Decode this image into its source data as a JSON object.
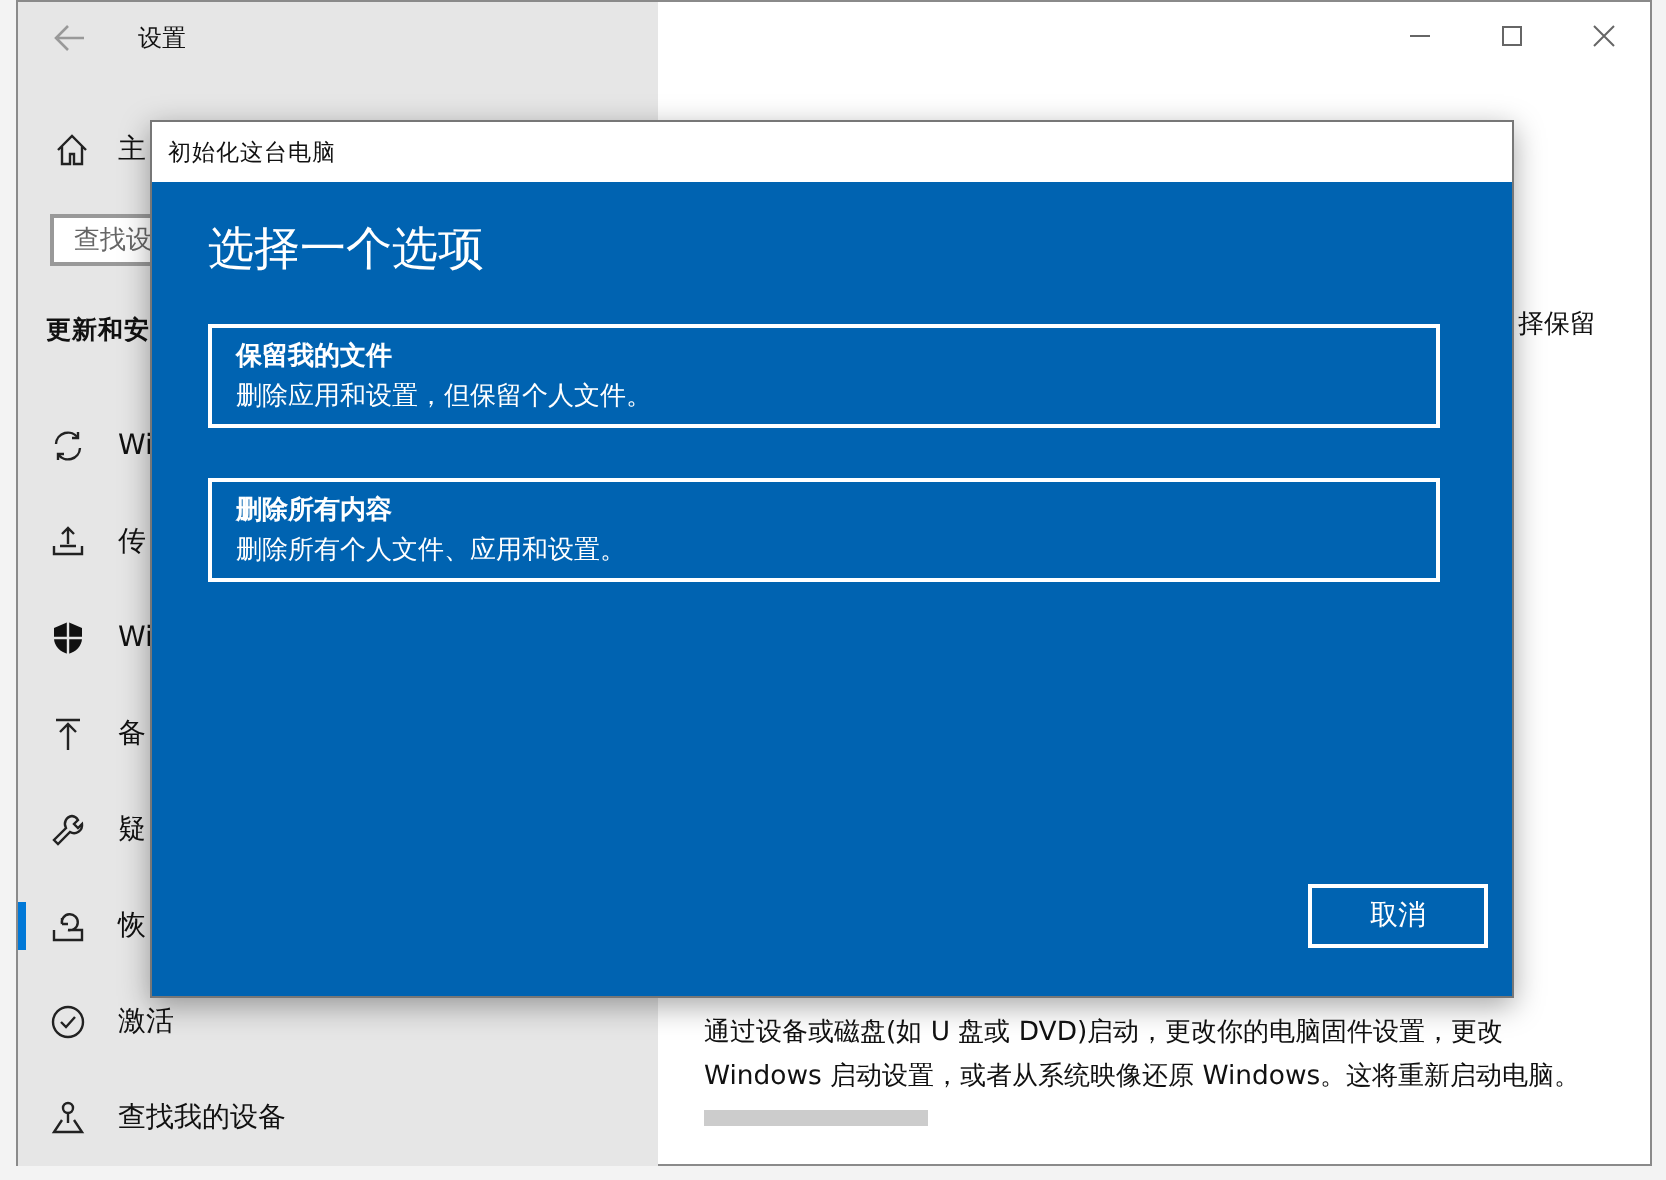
{
  "settings_window": {
    "title": "设置",
    "sidebar": {
      "home": "主",
      "search": {
        "placeholder": "查找设"
      },
      "heading": "更新和安",
      "items": [
        {
          "label": "Wi",
          "selected": false
        },
        {
          "label": "传",
          "selected": false
        },
        {
          "label": "Wi",
          "selected": false
        },
        {
          "label": "备",
          "selected": false
        },
        {
          "label": "疑",
          "selected": false
        },
        {
          "label": "恢",
          "selected": true
        },
        {
          "label": "激活",
          "selected": false
        },
        {
          "label": "查找我的设备",
          "selected": false
        }
      ]
    },
    "content": {
      "fragment": "择保留",
      "description": "通过设备或磁盘(如 U 盘或 DVD)启动，更改你的电脑固件设置，更改 Windows 启动设置，或者从系统映像还原 Windows。这将重新启动电脑。"
    }
  },
  "dialog": {
    "title": "初始化这台电脑",
    "heading": "选择一个选项",
    "options": [
      {
        "title": "保留我的文件",
        "description": "删除应用和设置，但保留个人文件。"
      },
      {
        "title": "删除所有内容",
        "description": "删除所有个人文件、应用和设置。"
      }
    ],
    "cancel": "取消"
  }
}
